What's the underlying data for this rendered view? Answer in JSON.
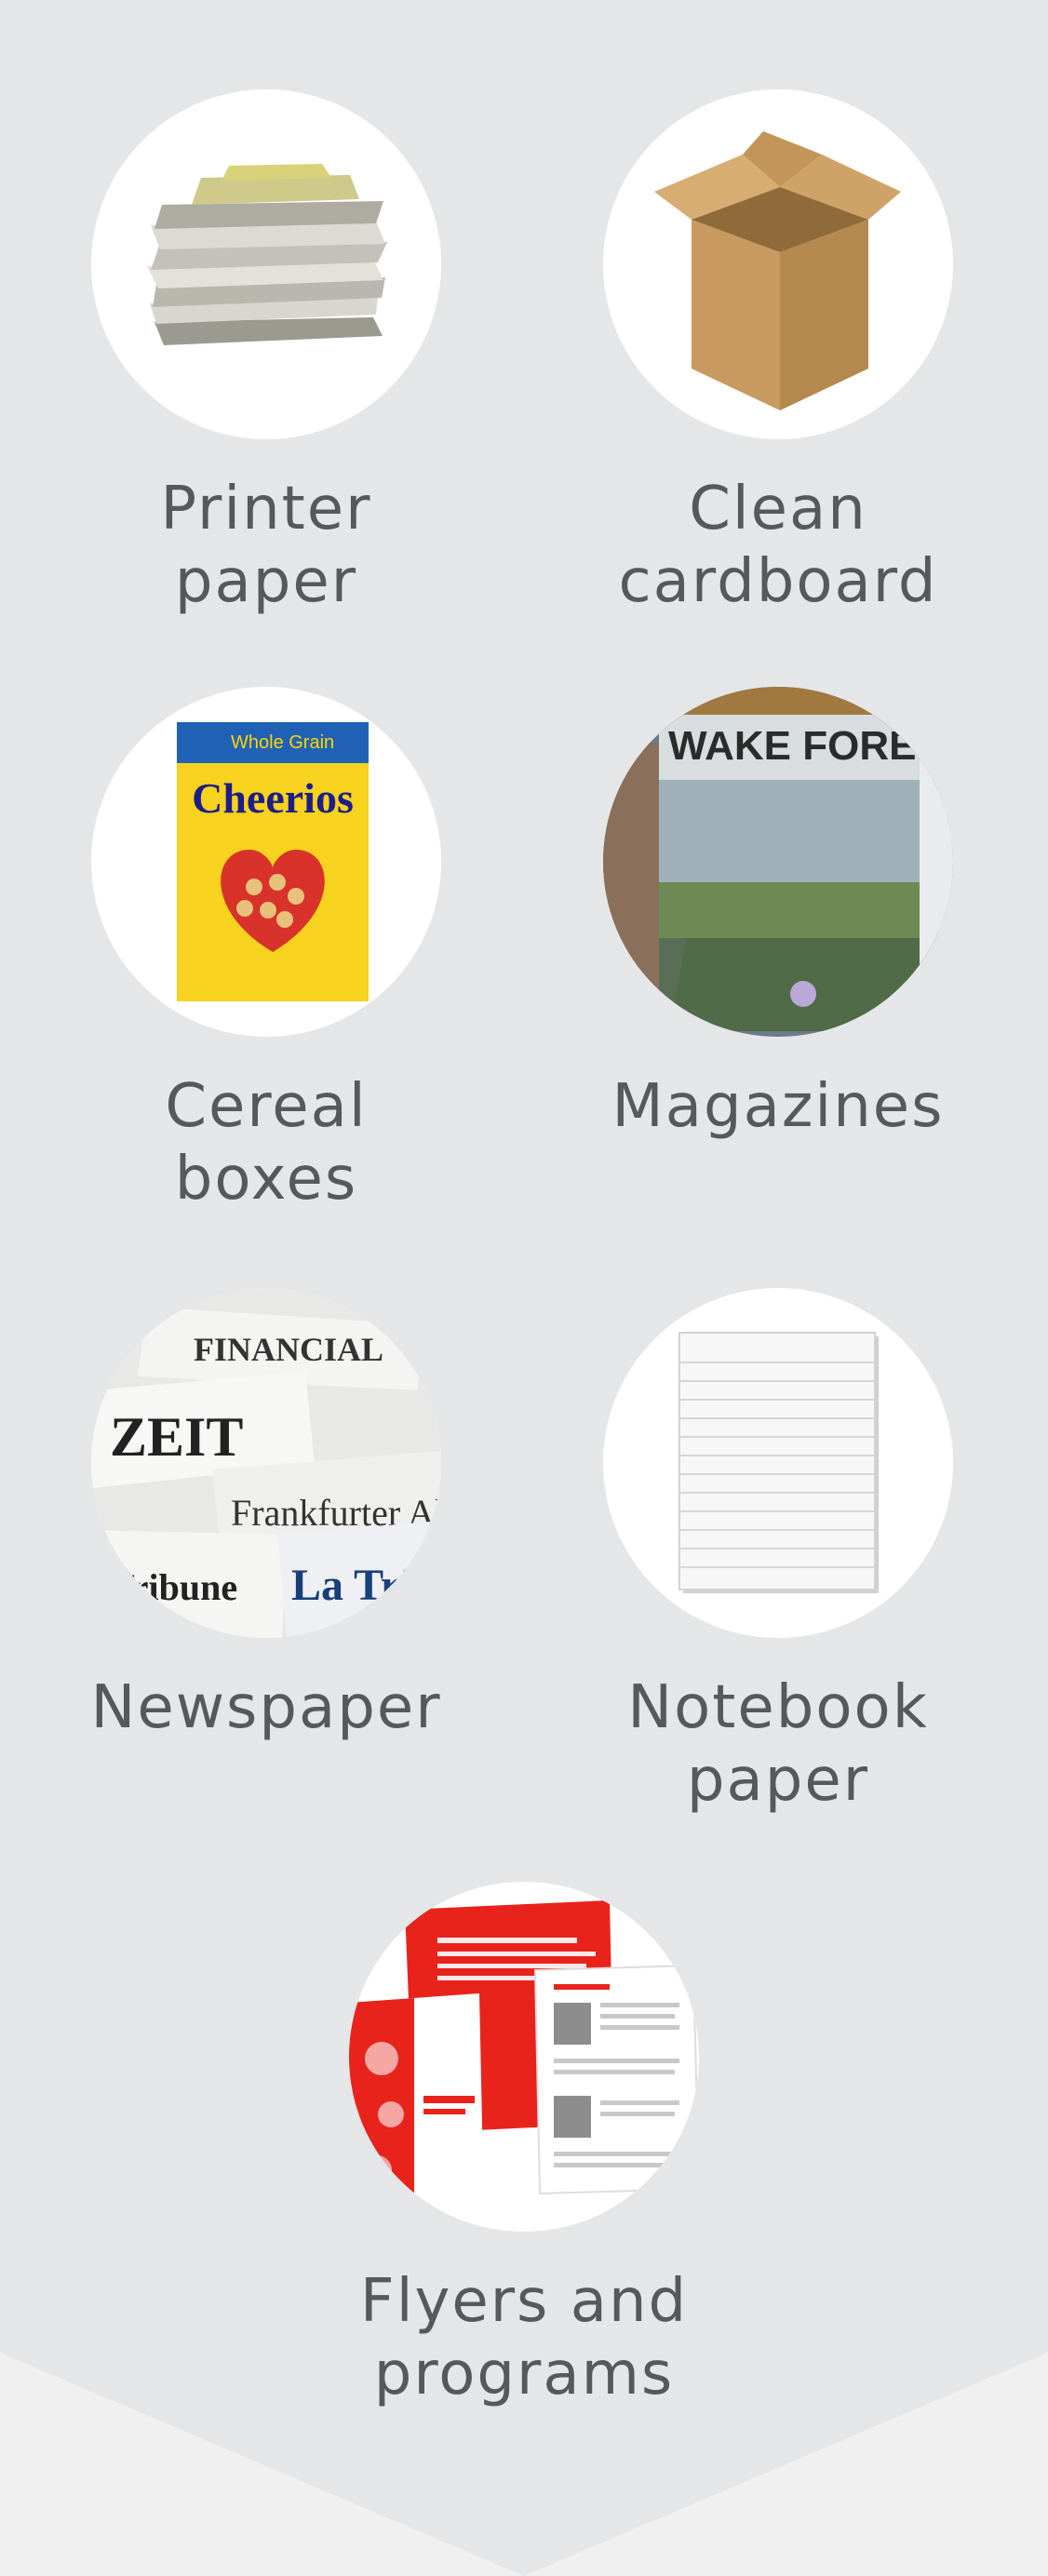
{
  "items": [
    {
      "label": "Printer paper",
      "icon": "paper-stack-icon"
    },
    {
      "label": "Clean\ncardboard",
      "icon": "cardboard-box-icon"
    },
    {
      "label": "Cereal boxes",
      "icon": "cereal-box-icon"
    },
    {
      "label": "Magazines",
      "icon": "magazine-icon"
    },
    {
      "label": "Newspaper",
      "icon": "newspaper-icon"
    },
    {
      "label": "Notebook\npaper",
      "icon": "notebook-paper-icon"
    },
    {
      "label": "Flyers and\nprograms",
      "icon": "flyer-icon"
    }
  ],
  "images": {
    "cereal_brand": "Cheerios",
    "cereal_badge": "Whole Grain",
    "magazine_title": "WAKE FOREST",
    "newspaper_headlines": [
      "FINANCIAL",
      "ZEIT",
      "Frankfurter All",
      "Tribune",
      "La Tri"
    ]
  },
  "colors": {
    "panel": "#e5e6e8",
    "background": "#f0f0f0",
    "label": "#56595c",
    "circle": "#ffffff"
  }
}
